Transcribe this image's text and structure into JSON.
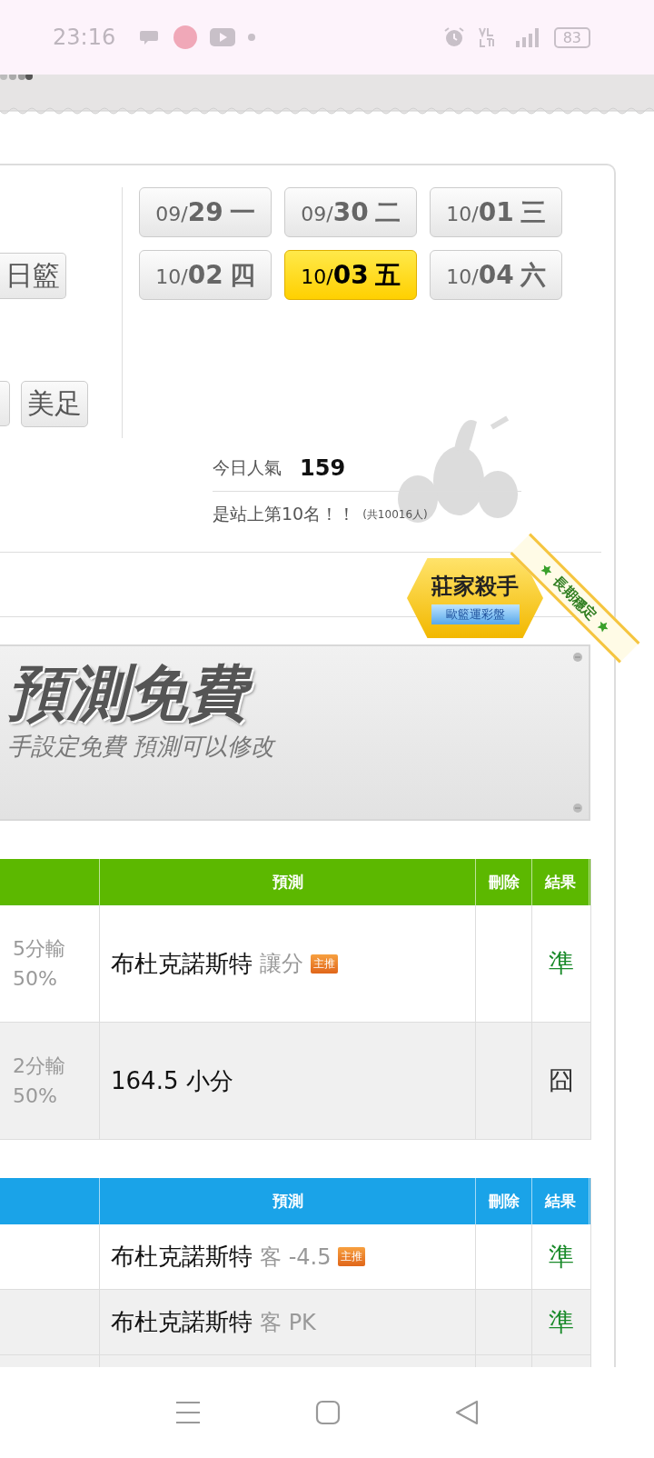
{
  "status_bar": {
    "time": "23:16",
    "battery": "83"
  },
  "sport_buttons": [
    {
      "label": "日籃"
    },
    {
      "label": "美足"
    }
  ],
  "dates": [
    {
      "month": "09/",
      "day": "29",
      "weekday": "一",
      "selected": false
    },
    {
      "month": "09/",
      "day": "30",
      "weekday": "二",
      "selected": false
    },
    {
      "month": "10/",
      "day": "01",
      "weekday": "三",
      "selected": false
    },
    {
      "month": "10/",
      "day": "02",
      "weekday": "四",
      "selected": false
    },
    {
      "month": "10/",
      "day": "03",
      "weekday": "五",
      "selected": true
    },
    {
      "month": "10/",
      "day": "04",
      "weekday": "六",
      "selected": false
    }
  ],
  "popularity": {
    "label": "今日人氣",
    "value": "159",
    "rank": "是站上第10名！！",
    "total": "(共10016人)"
  },
  "badge": {
    "title": "莊家殺手",
    "subtitle": "歐籃運彩盤",
    "ribbon": "長期穩定"
  },
  "banner": {
    "headline": "預測免費",
    "subline": "手設定免費 預測可以修改"
  },
  "tables": [
    {
      "color": "#5cb800",
      "columns": [
        "預測",
        "刪除",
        "結果"
      ],
      "rows": [
        {
          "odds": "5分輸",
          "share": "50%",
          "team": "布杜克諾斯特",
          "pick": "讓分",
          "tag": "主推",
          "result": "準",
          "kind": "hit"
        },
        {
          "odds": "2分輸",
          "share": "50%",
          "team": "",
          "pick": "164.5 小分",
          "tag": "",
          "result": "囧",
          "kind": "miss"
        }
      ]
    },
    {
      "color": "#1aa3e8",
      "columns": [
        "預測",
        "刪除",
        "結果"
      ],
      "rows": [
        {
          "odds": "",
          "share": "",
          "team": "布杜克諾斯特",
          "pick": "客 -4.5",
          "tag": "主推",
          "result": "準",
          "kind": "hit"
        },
        {
          "odds": "",
          "share": "",
          "team": "布杜克諾斯特",
          "pick": "客 PK",
          "tag": "",
          "result": "準",
          "kind": "hit"
        }
      ]
    }
  ]
}
